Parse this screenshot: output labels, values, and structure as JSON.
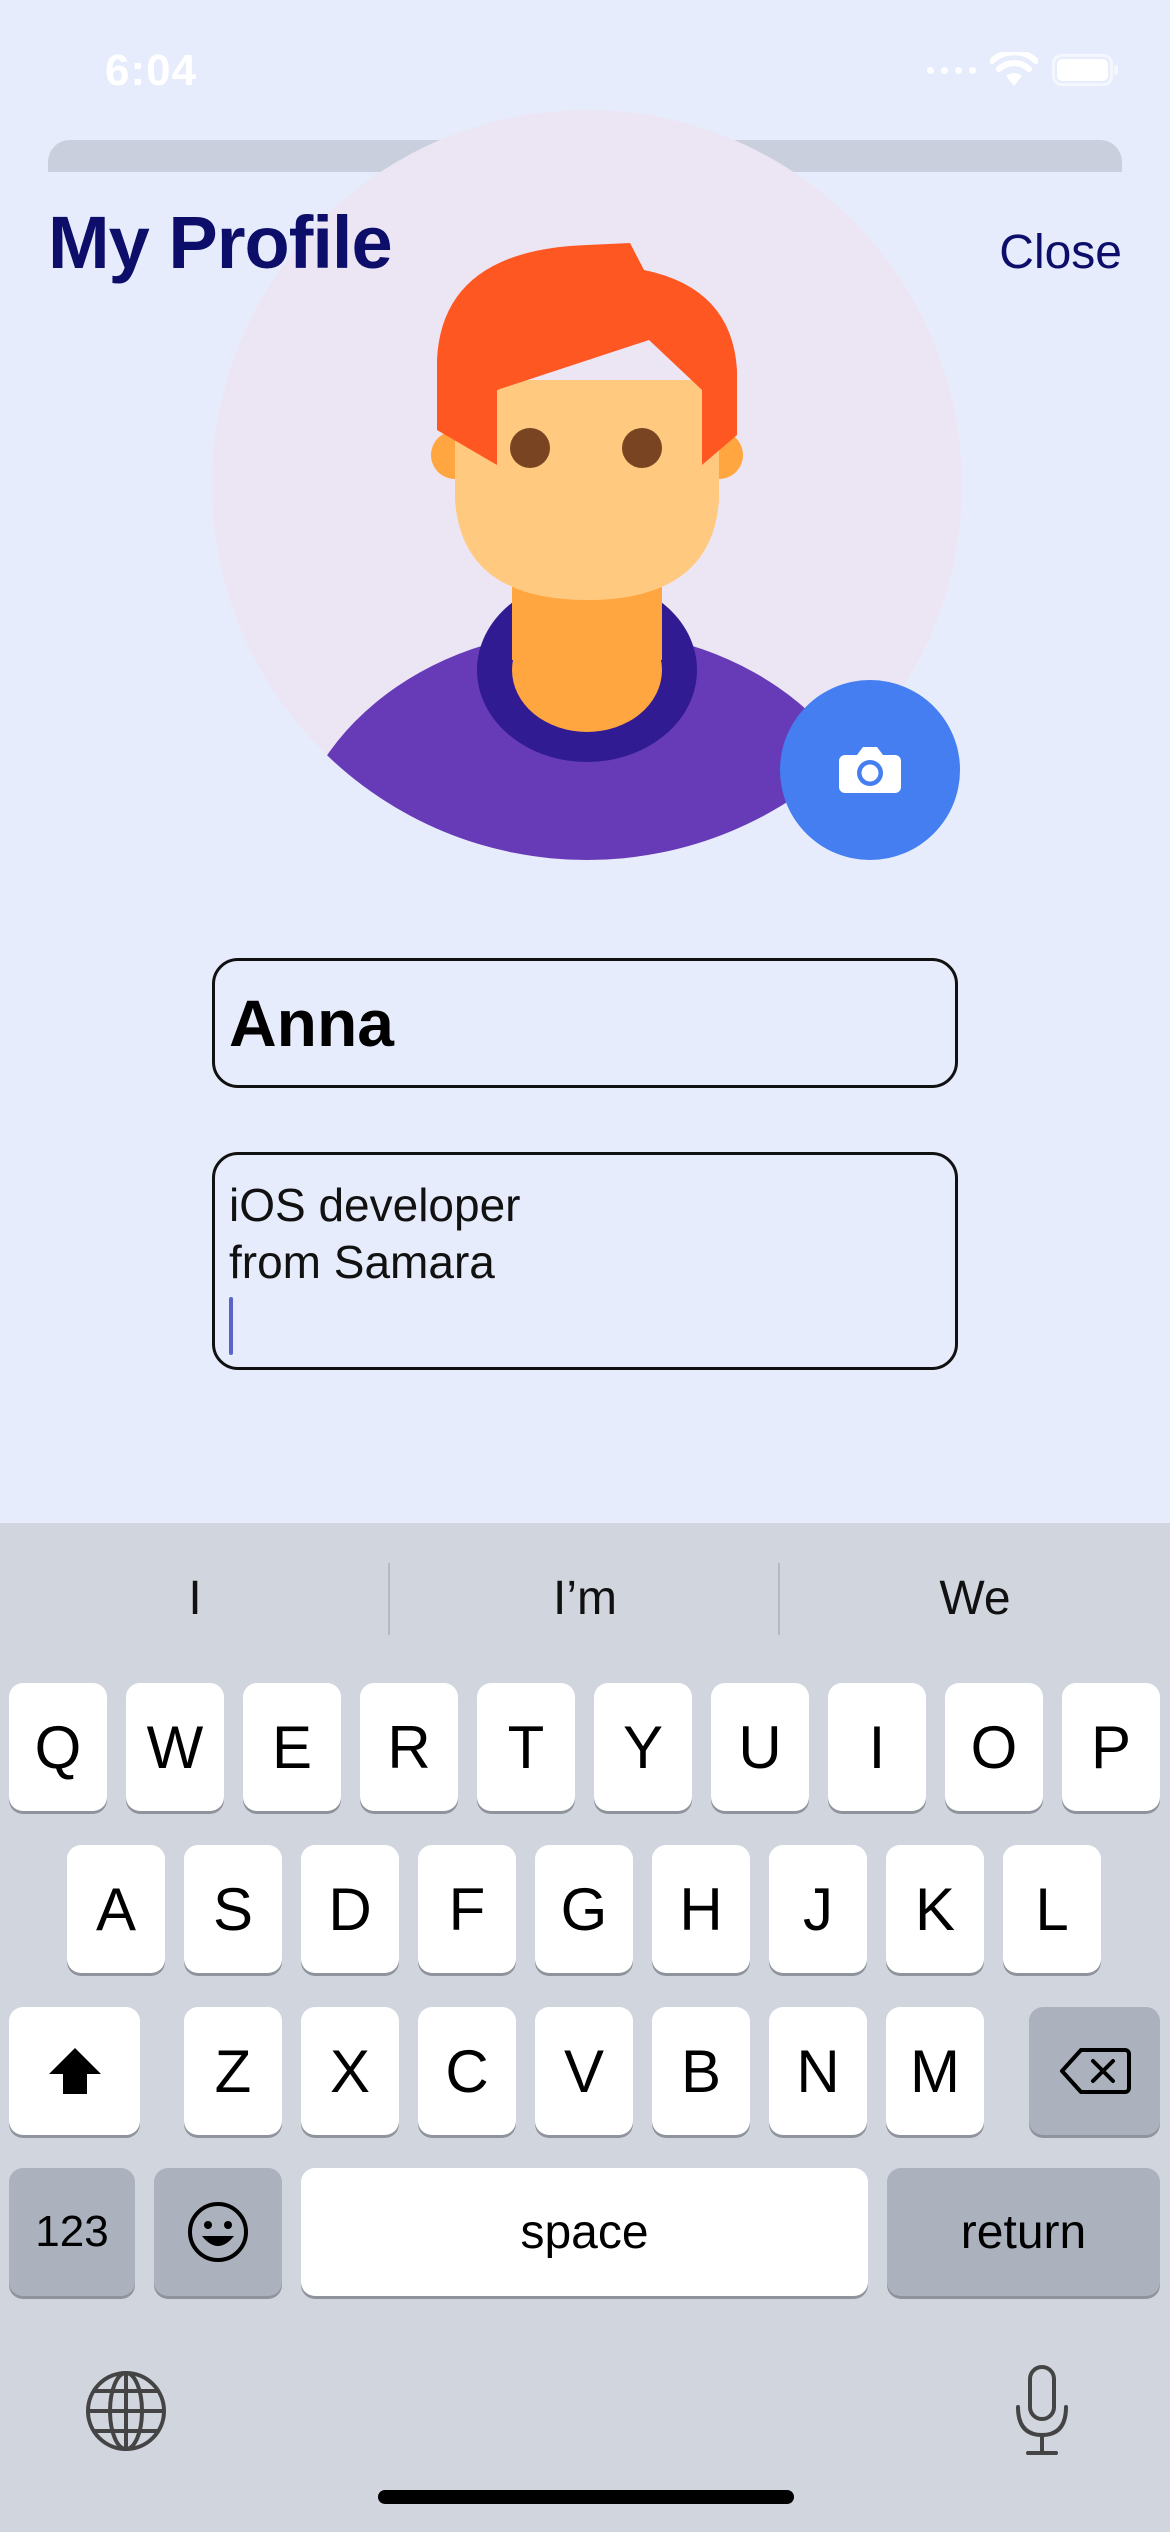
{
  "status_bar": {
    "time": "6:04"
  },
  "header": {
    "title": "My Profile",
    "close_label": "Close"
  },
  "profile": {
    "name": "Anna",
    "bio_lines": [
      "iOS developer",
      "from Samara"
    ]
  },
  "icons": {
    "avatar": "avatar-illustration",
    "camera": "camera-icon",
    "globe": "globe-icon",
    "mic": "microphone-icon",
    "shift": "shift-icon",
    "delete": "delete-icon",
    "emoji": "emoji-icon"
  },
  "colors": {
    "title": "#0d0e6a",
    "camera_button": "#447ef1",
    "background": "#e6ecfc"
  },
  "keyboard": {
    "suggestions": [
      "I",
      "I’m",
      "We"
    ],
    "row1": [
      "Q",
      "W",
      "E",
      "R",
      "T",
      "Y",
      "U",
      "I",
      "O",
      "P"
    ],
    "row2": [
      "A",
      "S",
      "D",
      "F",
      "G",
      "H",
      "J",
      "K",
      "L"
    ],
    "row3": [
      "Z",
      "X",
      "C",
      "V",
      "B",
      "N",
      "M"
    ],
    "numbers_label": "123",
    "space_label": "space",
    "return_label": "return"
  }
}
